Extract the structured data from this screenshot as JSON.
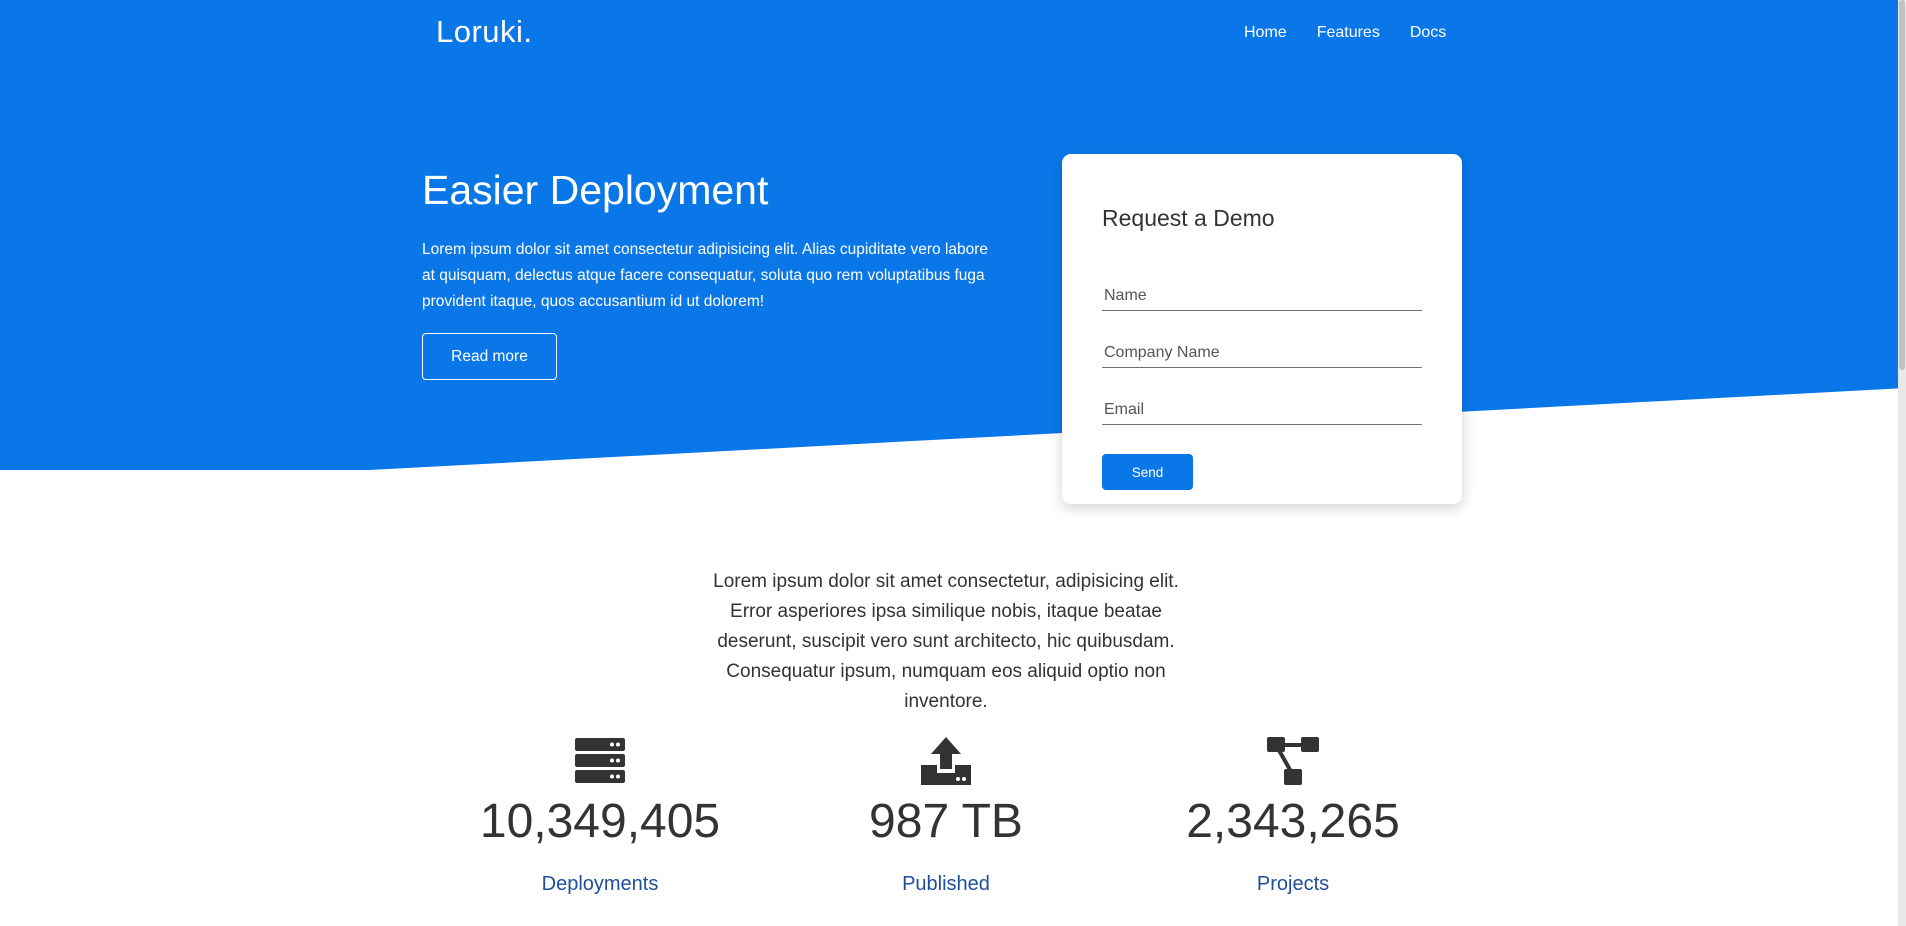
{
  "header": {
    "logo": "Loruki.",
    "nav": [
      "Home",
      "Features",
      "Docs"
    ]
  },
  "hero": {
    "title": "Easier Deployment",
    "text": "Lorem ipsum dolor sit amet consectetur adipisicing elit. Alias cupiditate vero labore at quisquam, delectus atque facere consequatur, soluta quo rem voluptatibus fuga provident itaque, quos accusantium id ut dolorem!",
    "read_more_label": "Read more"
  },
  "demo_form": {
    "title": "Request a Demo",
    "name_placeholder": "Name",
    "company_placeholder": "Company Name",
    "email_placeholder": "Email",
    "send_label": "Send"
  },
  "intro": {
    "text": "Lorem ipsum dolor sit amet consectetur, adipisicing elit. Error asperiores ipsa similique nobis, itaque beatae deserunt, suscipit vero sunt architecto, hic quibusdam. Consequatur ipsum, numquam eos aliquid optio non inventore."
  },
  "stats": [
    {
      "icon": "server-icon",
      "value": "10,349,405",
      "label": "Deployments"
    },
    {
      "icon": "upload-icon",
      "value": "987 TB",
      "label": "Published"
    },
    {
      "icon": "project-diagram-icon",
      "value": "2,343,265",
      "label": "Projects"
    }
  ],
  "colors": {
    "primary": "#0A77E8",
    "text_dark": "#333333",
    "stat_label": "#1F4E9B"
  }
}
